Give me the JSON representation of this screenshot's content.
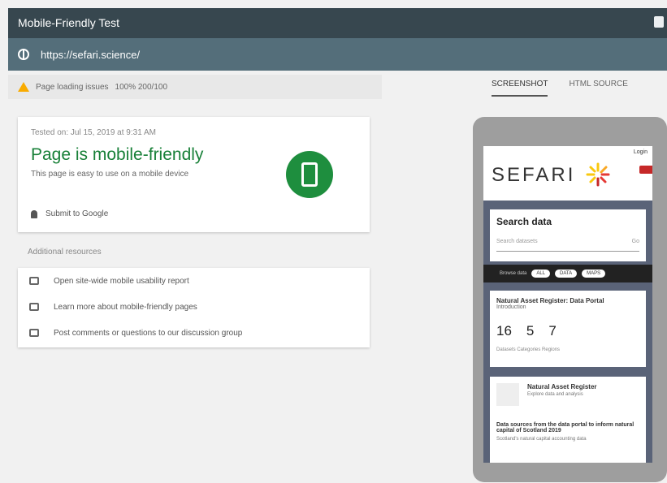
{
  "header": {
    "title": "Mobile-Friendly Test"
  },
  "url_bar": {
    "url": "https://sefari.science/"
  },
  "warning": {
    "text": "Page loading issues",
    "link": "100% 200/100"
  },
  "tabs": [
    {
      "label": "SCREENSHOT"
    },
    {
      "label": "HTML SOURCE"
    }
  ],
  "result": {
    "tested_time": "Tested on: Jul 15, 2019 at 9:31 AM",
    "headline": "Page is mobile-friendly",
    "subtext": "This page is easy to use on a mobile device",
    "link": "Submit to Google"
  },
  "additional": {
    "label": "Additional resources",
    "items": [
      "Open site-wide mobile usability report",
      "Learn more about mobile-friendly pages",
      "Post comments or questions to our discussion group"
    ]
  },
  "preview": {
    "login": "Login",
    "logo": "SEFARI",
    "search_title": "Search data",
    "search_placeholder": "Search datasets",
    "search_go": "Go",
    "filter_label": "Browse data",
    "filters": [
      "ALL",
      "DATA",
      "MAPS"
    ],
    "stats_title": "Natural Asset Register: Data Portal",
    "stats_sub": "Introduction",
    "stats": [
      "16",
      "5",
      "7"
    ],
    "stats_foot": "Datasets   Categories   Regions",
    "reg_title": "Natural Asset Register",
    "reg_sub": "Explore data and analysis",
    "reg_body": "Data sources from the data portal to inform natural capital of Scotland 2019",
    "reg_foot": "Scotland's natural capital accounting data"
  }
}
